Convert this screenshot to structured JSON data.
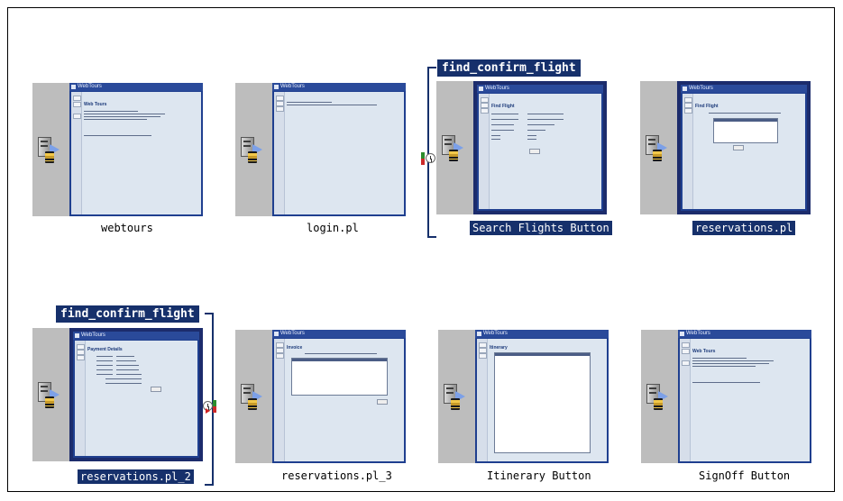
{
  "steps": [
    {
      "label": "webtours",
      "screen_title": "Web Tours",
      "brand": "WebTours"
    },
    {
      "label": "login.pl",
      "screen_title": "",
      "brand": "WebTours"
    },
    {
      "label": "Search Flights Button",
      "screen_title": "Find Flight",
      "brand": "WebTours"
    },
    {
      "label": "reservations.pl",
      "screen_title": "Find Flight",
      "brand": "WebTours"
    },
    {
      "label": "reservations.pl_2",
      "screen_title": "Payment Details",
      "brand": "WebTours"
    },
    {
      "label": "reservations.pl_3",
      "screen_title": "Invoice",
      "brand": "WebTours"
    },
    {
      "label": "Itinerary Button",
      "screen_title": "Itinerary",
      "brand": "WebTours"
    },
    {
      "label": "SignOff Button",
      "screen_title": "Web Tours",
      "brand": "WebTours"
    }
  ],
  "transactions": [
    {
      "name": "find_confirm_flight"
    },
    {
      "name": "find_confirm_flight"
    }
  ],
  "colors": {
    "selection": "#16306b",
    "thumbnail_bg": "#dde6f0",
    "server_panel": "#bdbdbd"
  },
  "icons": [
    "server-icon",
    "arrow-icon",
    "hourglass-icon",
    "transaction-start-icon",
    "transaction-end-icon"
  ]
}
